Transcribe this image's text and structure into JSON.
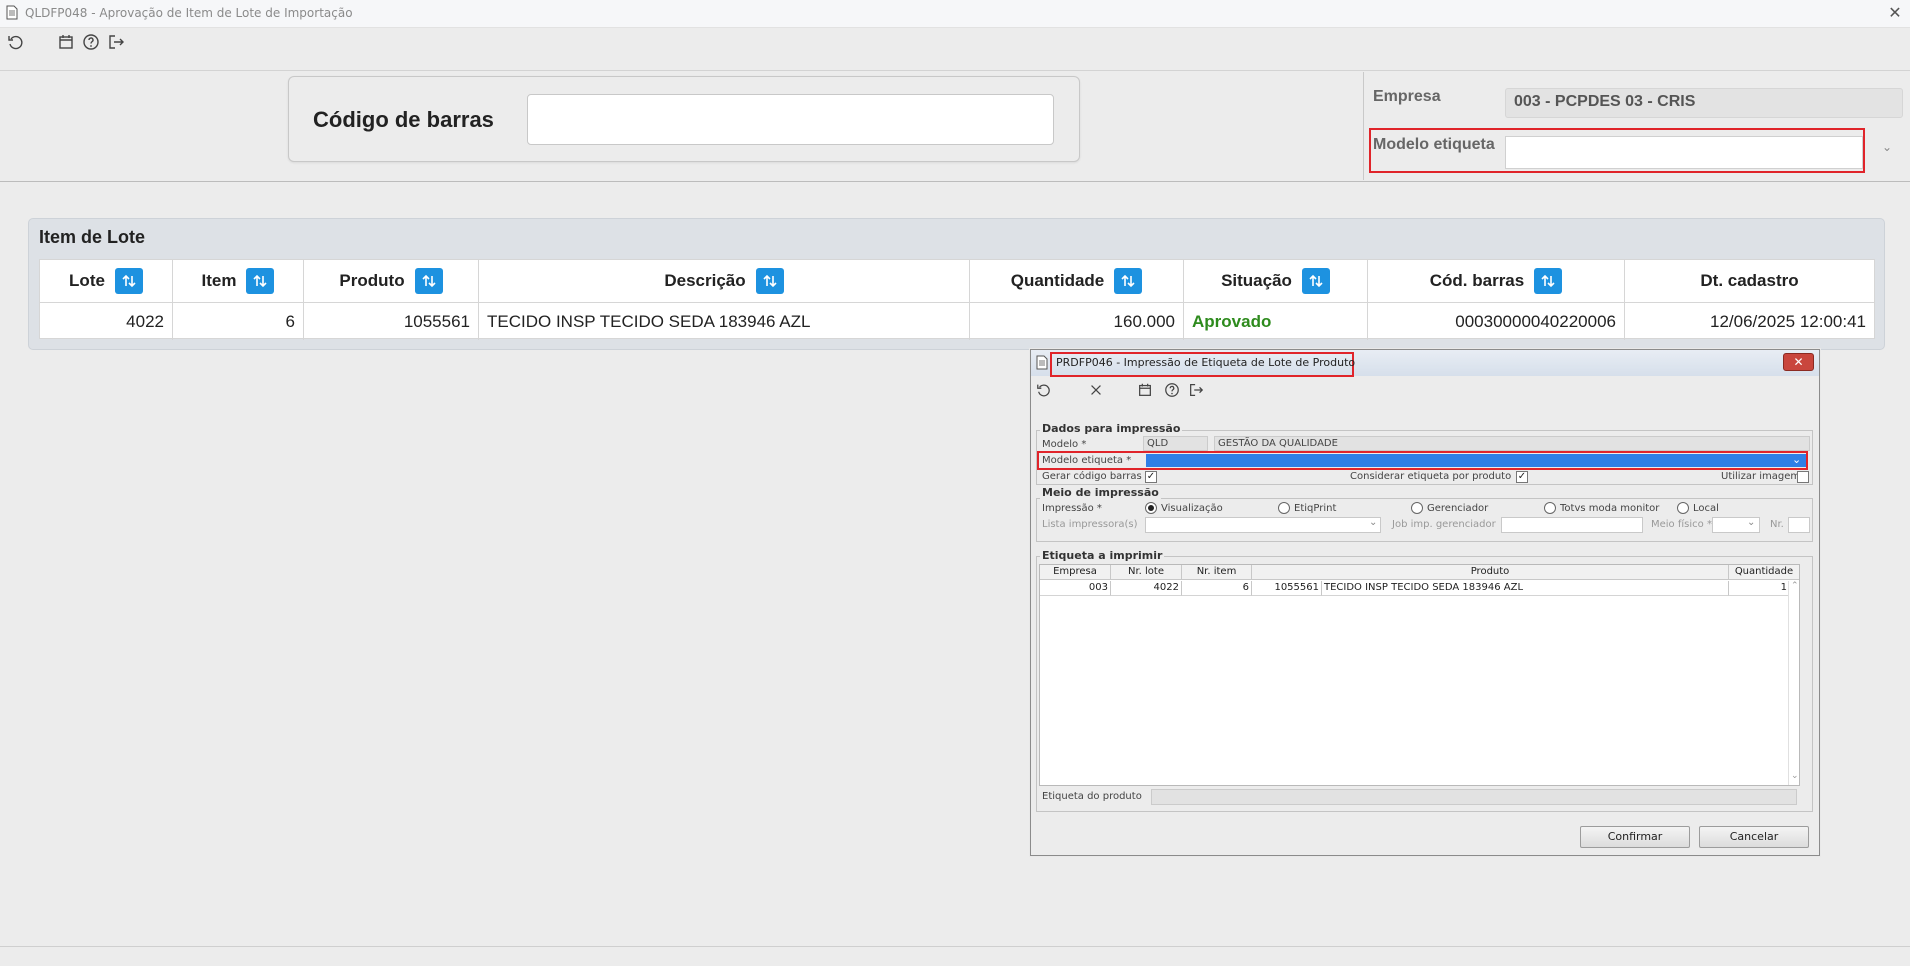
{
  "window": {
    "title": "QLDFP048 - Aprovação de Item de Lote de Importação",
    "close_glyph": "✕"
  },
  "toolbar": {
    "icons": [
      "refresh-icon",
      "calendar-icon",
      "help-icon",
      "exit-icon"
    ]
  },
  "barcode": {
    "label": "Código de barras",
    "value": ""
  },
  "empresa": {
    "label": "Empresa",
    "value": "003 - PCPDES 03 - CRIS"
  },
  "modelo_etiqueta": {
    "label": "Modelo etiqueta",
    "value": "",
    "chevron": "⌄"
  },
  "item_lote": {
    "title": "Item de Lote",
    "columns": [
      "Lote",
      "Item",
      "Produto",
      "Descrição",
      "Quantidade",
      "Situação",
      "Cód. barras",
      "Dt. cadastro"
    ],
    "row": {
      "lote": "4022",
      "item": "6",
      "produto": "1055561",
      "descricao": "TECIDO INSP TECIDO SEDA 183946 AZL",
      "quantidade": "160.000",
      "situacao": "Aprovado",
      "cod_barras": "00030000040220006",
      "dt_cadastro": "12/06/2025 12:00:41"
    },
    "status_color": "#2e8b1d",
    "sort_color": "#1d92e0"
  },
  "dialog": {
    "title": "PRDFP046 - Impressão de Etiqueta de Lote de Produto",
    "close_glyph": "✕",
    "toolbar_icons": [
      "refresh-icon",
      "cancel-icon",
      "calendar-icon",
      "help-icon",
      "exit-icon"
    ],
    "dados": {
      "legend": "Dados para impressão",
      "modelo_label": "Modelo *",
      "modelo_code": "QLD",
      "modelo_desc": "GESTÃO DA QUALIDADE",
      "modelo_etiqueta_label": "Modelo etiqueta *",
      "modelo_etiqueta_value": "",
      "gerar_label": "Gerar código barras",
      "gerar_checked": true,
      "considerar_label": "Considerar etiqueta por produto",
      "considerar_checked": true,
      "utilizar_label": "Utilizar imagem",
      "utilizar_checked": false,
      "selection_color": "#2f7fe6"
    },
    "meio": {
      "legend": "Meio de impressão",
      "impressao_label": "Impressão *",
      "options": [
        "Visualização",
        "EtiqPrint",
        "Gerenciador",
        "Totvs moda monitor",
        "Local"
      ],
      "selected": "Visualização",
      "lista_label": "Lista impressora(s)",
      "job_label": "Job imp. gerenciador",
      "meio_fisico_label": "Meio físico *",
      "nr_label": "Nr."
    },
    "etiqueta": {
      "legend": "Etiqueta a imprimir",
      "columns": [
        "Empresa",
        "Nr. lote",
        "Nr. item",
        "Produto",
        "Quantidade"
      ],
      "row": {
        "empresa": "003",
        "nr_lote": "4022",
        "nr_item": "6",
        "produto_code": "1055561",
        "produto_desc": "TECIDO INSP TECIDO SEDA 183946 AZL",
        "quantidade": "1"
      },
      "produto_label": "Etiqueta do produto"
    },
    "buttons": {
      "confirm": "Confirmar",
      "cancel": "Cancelar"
    }
  }
}
